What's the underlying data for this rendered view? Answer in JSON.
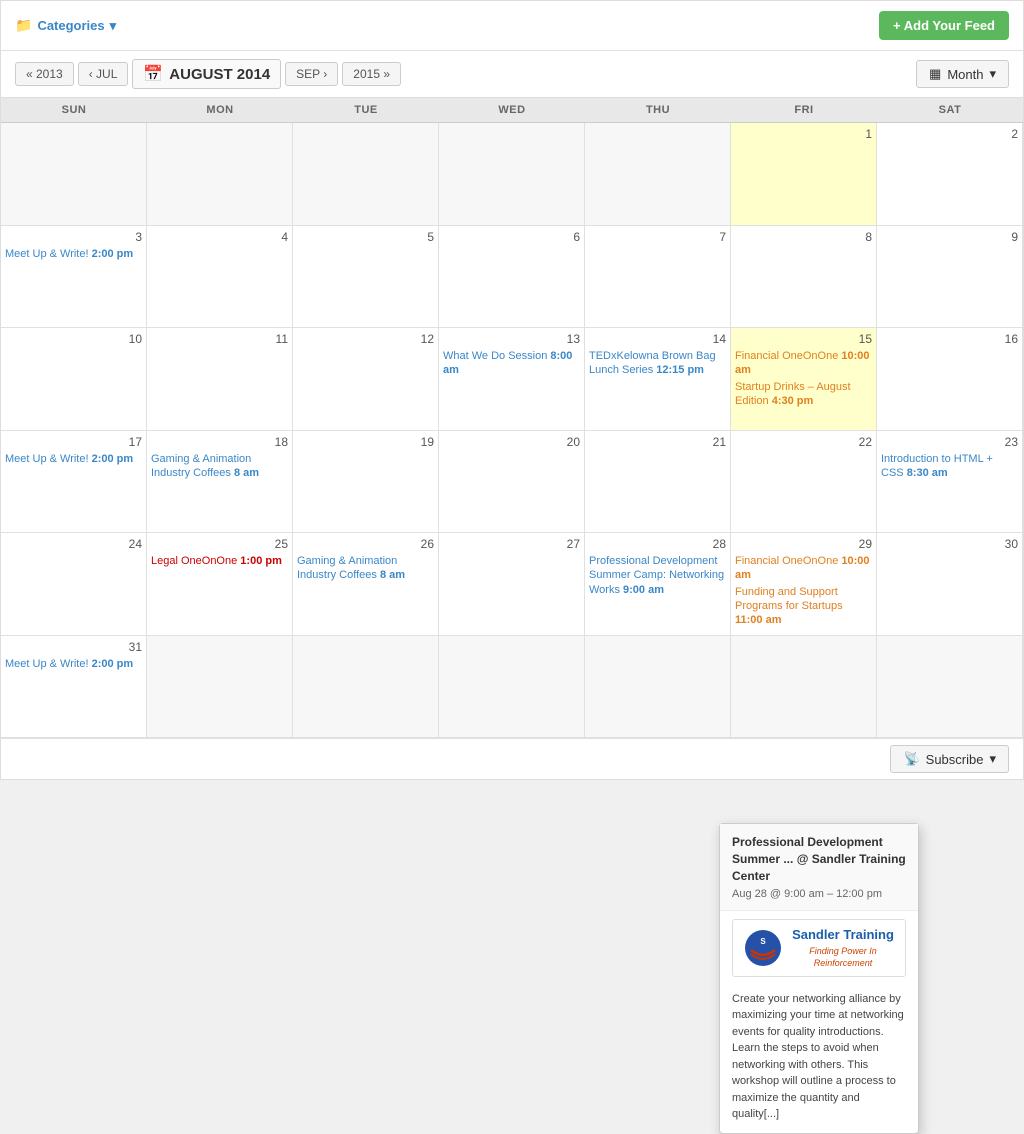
{
  "toolbar": {
    "categories_label": "Categories",
    "add_feed_label": "+ Add Your Feed"
  },
  "nav": {
    "prev_year": "« 2013",
    "prev_month": "‹ JUL",
    "current_month": "AUGUST 2014",
    "next_month": "SEP ›",
    "next_year": "2015 »",
    "view_label": "Month"
  },
  "day_headers": [
    "SUN",
    "MON",
    "TUE",
    "WED",
    "THU",
    "FRI",
    "SAT"
  ],
  "popup": {
    "title": "Professional Development Summer ... @ Sandler Training Center",
    "date": "Aug 28 @ 9:00 am – 12:00 pm",
    "logo_name": "Sandler Training",
    "logo_tagline": "Finding Power In Reinforcement",
    "description": "Create your networking alliance by maximizing your time at networking events for quality introductions. Learn the steps to avoid when networking with others. This workshop will outline a process to maximize the quantity and quality[...]"
  },
  "subscribe": {
    "label": "Subscribe"
  },
  "weeks": [
    {
      "days": [
        {
          "num": "",
          "other": true,
          "events": []
        },
        {
          "num": "",
          "other": true,
          "events": []
        },
        {
          "num": "",
          "other": true,
          "events": []
        },
        {
          "num": "",
          "other": true,
          "events": []
        },
        {
          "num": "",
          "other": true,
          "events": []
        },
        {
          "num": "1",
          "highlighted": true,
          "events": []
        },
        {
          "num": "2",
          "events": []
        }
      ]
    },
    {
      "days": [
        {
          "num": "3",
          "events": [
            {
              "text": "Meet Up & Write!",
              "time": "2:00 pm",
              "color": "blue"
            }
          ]
        },
        {
          "num": "4",
          "events": []
        },
        {
          "num": "5",
          "events": []
        },
        {
          "num": "6",
          "events": []
        },
        {
          "num": "7",
          "events": []
        },
        {
          "num": "8",
          "events": []
        },
        {
          "num": "9",
          "events": []
        }
      ]
    },
    {
      "days": [
        {
          "num": "10",
          "events": []
        },
        {
          "num": "11",
          "events": []
        },
        {
          "num": "12",
          "events": []
        },
        {
          "num": "13",
          "events": [
            {
              "text": "What We Do Session",
              "time": "8:00 am",
              "color": "blue"
            }
          ]
        },
        {
          "num": "14",
          "events": [
            {
              "text": "TEDxKelowna Brown Bag Lunch Series",
              "time": "12:15 pm",
              "color": "blue"
            }
          ]
        },
        {
          "num": "15",
          "highlighted": true,
          "events": [
            {
              "text": "Financial OneOnOne",
              "time": "10:00 am",
              "color": "orange"
            },
            {
              "text": "Startup Drinks – August Edition",
              "time": "4:30 pm",
              "color": "orange"
            }
          ]
        },
        {
          "num": "16",
          "events": []
        }
      ]
    },
    {
      "days": [
        {
          "num": "17",
          "events": [
            {
              "text": "Meet Up & Write!",
              "time": "2:00 pm",
              "color": "blue"
            }
          ]
        },
        {
          "num": "18",
          "events": [
            {
              "text": "Gaming & Animation Industry Coffees",
              "time": "8 am",
              "color": "blue"
            }
          ]
        },
        {
          "num": "19",
          "events": []
        },
        {
          "num": "20",
          "events": []
        },
        {
          "num": "21",
          "events": []
        },
        {
          "num": "22",
          "events": []
        },
        {
          "num": "23",
          "events": [
            {
              "text": "Introduction to HTML + CSS",
              "time": "8:30 am",
              "color": "blue"
            }
          ]
        }
      ]
    },
    {
      "days": [
        {
          "num": "24",
          "events": []
        },
        {
          "num": "25",
          "events": [
            {
              "text": "Legal OneOnOne",
              "time": "1:00 pm",
              "color": "red"
            }
          ]
        },
        {
          "num": "26",
          "events": [
            {
              "text": "Gaming & Animation Industry Coffees",
              "time": "8 am",
              "color": "blue"
            }
          ]
        },
        {
          "num": "27",
          "popup": true,
          "events": []
        },
        {
          "num": "28",
          "events": [
            {
              "text": "Professional Development Summer Camp: Networking Works",
              "time": "9:00 am",
              "color": "blue"
            }
          ]
        },
        {
          "num": "29",
          "events": [
            {
              "text": "Financial OneOnOne",
              "time": "10:00 am",
              "color": "orange"
            },
            {
              "text": "Funding and Support Programs for Startups",
              "time": "11:00 am",
              "color": "orange"
            }
          ]
        },
        {
          "num": "30",
          "events": []
        }
      ]
    },
    {
      "days": [
        {
          "num": "31",
          "events": [
            {
              "text": "Meet Up & Write!",
              "time": "2:00 pm",
              "color": "blue"
            }
          ]
        },
        {
          "num": "",
          "other": true,
          "events": []
        },
        {
          "num": "",
          "other": true,
          "events": []
        },
        {
          "num": "",
          "other": true,
          "events": []
        },
        {
          "num": "",
          "other": true,
          "events": []
        },
        {
          "num": "",
          "other": true,
          "events": []
        },
        {
          "num": "",
          "other": true,
          "events": []
        }
      ]
    }
  ]
}
